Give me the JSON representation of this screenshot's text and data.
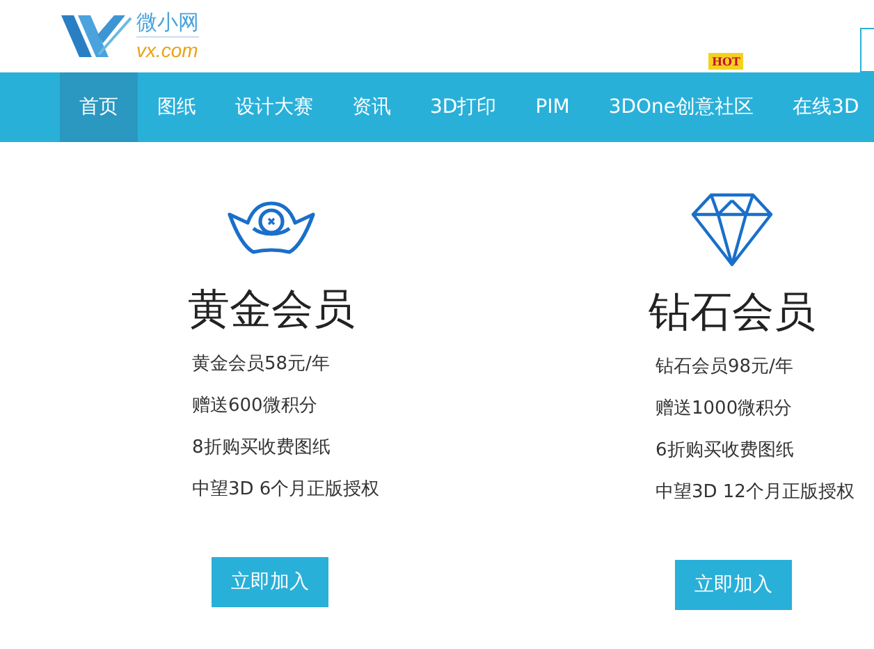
{
  "logo": {
    "name": "微小网",
    "domain": "vx.com"
  },
  "nav": [
    {
      "label": "首页",
      "selected": true,
      "hot": false
    },
    {
      "label": "图纸",
      "selected": false,
      "hot": false
    },
    {
      "label": "设计大赛",
      "selected": false,
      "hot": false
    },
    {
      "label": "资讯",
      "selected": false,
      "hot": false
    },
    {
      "label": "3D打印",
      "selected": false,
      "hot": false
    },
    {
      "label": "PIM",
      "selected": false,
      "hot": false
    },
    {
      "label": "3DOne创意社区",
      "selected": false,
      "hot": true,
      "badge": "HOT"
    },
    {
      "label": "在线3D",
      "selected": false,
      "hot": false
    }
  ],
  "plans": [
    {
      "kind": "gold",
      "title": "黄金会员",
      "features": [
        "黄金会员58元/年",
        "赠送600微积分",
        "8折购买收费图纸",
        "中望3D 6个月正版授权"
      ],
      "button": "立即加入"
    },
    {
      "kind": "diamond",
      "title": "钻石会员",
      "features": [
        "钻石会员98元/年",
        "赠送1000微积分",
        "6折购买收费图纸",
        "中望3D 12个月正版授权"
      ],
      "button": "立即加入"
    }
  ]
}
